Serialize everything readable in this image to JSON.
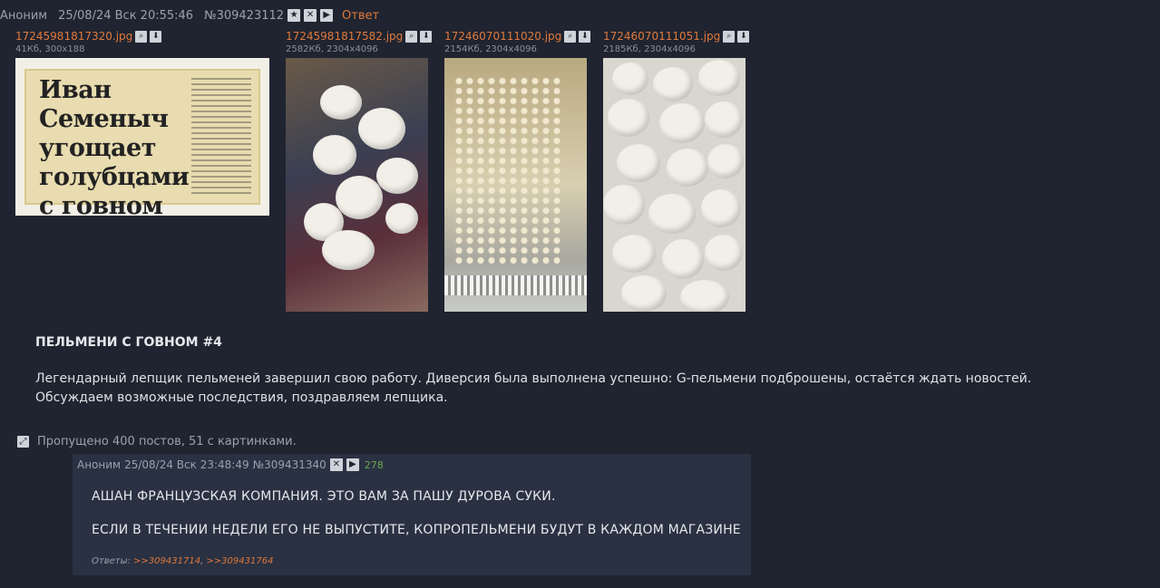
{
  "op": {
    "author": "Аноним",
    "date": "25/08/24 Вск 20:55:46",
    "number": "№309423112",
    "reply_label": "Ответ",
    "files": [
      {
        "name": "17245981817320.jpg",
        "size": "41Кб, 300x188"
      },
      {
        "name": "17245981817582.jpg",
        "size": "2582Кб, 2304x4096"
      },
      {
        "name": "17246070111020.jpg",
        "size": "2154Кб, 2304x4096"
      },
      {
        "name": "17246070111051.jpg",
        "size": "2185Кб, 2304x4096"
      }
    ],
    "clipping_text": "Иван Семеныч угощает голубцами с говном",
    "title": "ПЕЛЬМЕНИ С ГОВНОМ #4",
    "text_line1": "Легендарный лепщик пельменей завершил свою работу. Диверсия была выполнена успешно: G-пельмени подброшены, остаётся ждать новостей.",
    "text_line2": "Обсуждаем возможные последствия, поздравляем лепщика."
  },
  "omitted": "Пропущено 400 постов, 51 с картинками.",
  "reply": {
    "author": "Аноним",
    "date": "25/08/24 Вск 23:48:49",
    "number": "№309431340",
    "count": "278",
    "line1": "АШАН ФРАНЦУЗСКАЯ КОМПАНИЯ. ЭТО ВАМ ЗА ПАШУ ДУРОВА СУКИ.",
    "line2": "ЕСЛИ В ТЕЧЕНИИ НЕДЕЛИ ЕГО НЕ ВЫПУСТИТЕ, КОПРОПЕЛЬМЕНИ БУДУТ В КАЖДОМ МАГАЗИНЕ",
    "answers_label": "Ответы:",
    "answers": [
      ">>309431714",
      ">>309431764"
    ]
  },
  "icons": {
    "star": "★",
    "close": "✕",
    "play": "▶",
    "search": "🔍",
    "download": "⬇",
    "expand": "⤢"
  }
}
